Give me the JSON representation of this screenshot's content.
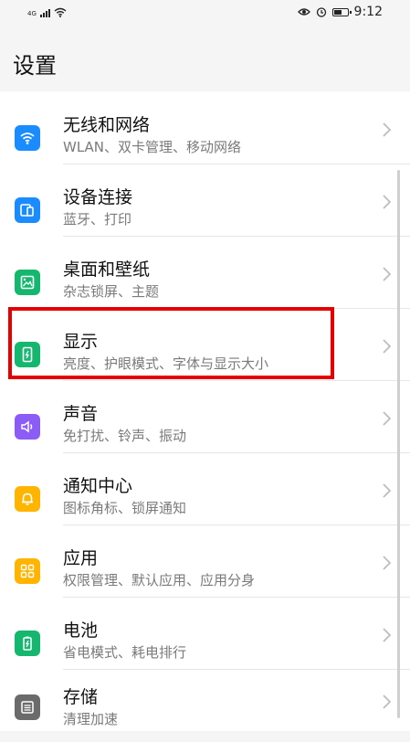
{
  "status_bar": {
    "network": "4G",
    "time": "9:12"
  },
  "page": {
    "title": "设置"
  },
  "items": [
    {
      "title": "无线和网络",
      "subtitle": "WLAN、双卡管理、移动网络",
      "icon": "wifi-icon",
      "color": "#1a8cff"
    },
    {
      "title": "设备连接",
      "subtitle": "蓝牙、打印",
      "icon": "device-connection-icon",
      "color": "#1a8cff"
    },
    {
      "title": "桌面和壁纸",
      "subtitle": "杂志锁屏、主题",
      "icon": "wallpaper-icon",
      "color": "#15b66e"
    },
    {
      "title": "显示",
      "subtitle": "亮度、护眼模式、字体与显示大小",
      "icon": "display-icon",
      "color": "#15b66e"
    },
    {
      "title": "声音",
      "subtitle": "免打扰、铃声、振动",
      "icon": "sound-icon",
      "color": "#8b5cf6"
    },
    {
      "title": "通知中心",
      "subtitle": "图标角标、锁屏通知",
      "icon": "bell-icon",
      "color": "#ffb400"
    },
    {
      "title": "应用",
      "subtitle": "权限管理、默认应用、应用分身",
      "icon": "apps-icon",
      "color": "#ffb400"
    },
    {
      "title": "电池",
      "subtitle": "省电模式、耗电排行",
      "icon": "battery-icon",
      "color": "#15b66e"
    },
    {
      "title": "存储",
      "subtitle": "清理加速",
      "icon": "storage-icon",
      "color": "#6b6b6b"
    }
  ],
  "highlight_color": "#e60000"
}
